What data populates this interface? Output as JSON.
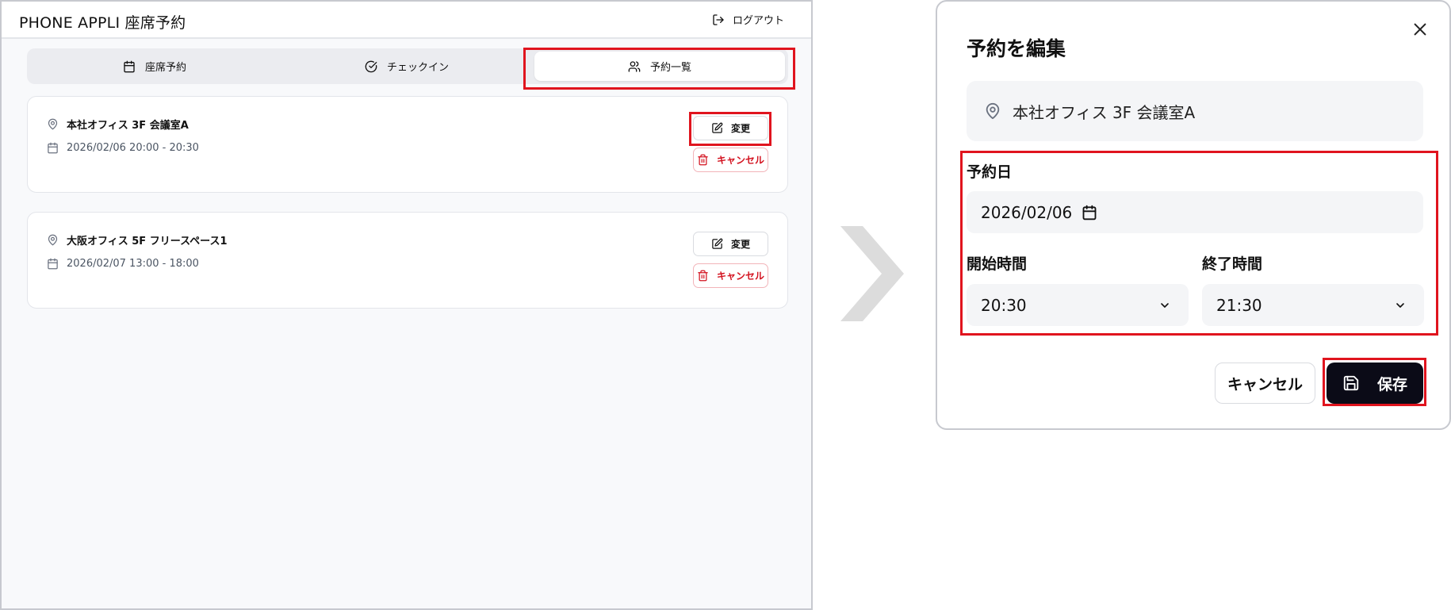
{
  "app": {
    "brand": "PHONE APPLI 座席予約",
    "logout_label": "ログアウト",
    "tabs": [
      {
        "label": "座席予約",
        "icon": "calendar-icon",
        "active": false
      },
      {
        "label": "チェックイン",
        "icon": "check-circle-icon",
        "active": false
      },
      {
        "label": "予約一覧",
        "icon": "users-icon",
        "active": true
      }
    ],
    "reservations": [
      {
        "location": "本社オフィス 3F 会議室A",
        "datetime": "2026/02/06 20:00 - 20:30",
        "edit_label": "変更",
        "cancel_label": "キャンセル"
      },
      {
        "location": "大阪オフィス 5F フリースペース1",
        "datetime": "2026/02/07 13:00 - 18:00",
        "edit_label": "変更",
        "cancel_label": "キャンセル"
      }
    ]
  },
  "modal": {
    "title": "予約を編集",
    "location": "本社オフィス 3F 会議室A",
    "date_label": "予約日",
    "date_value": "2026/02/06",
    "start_label": "開始時間",
    "start_value": "20:30",
    "end_label": "終了時間",
    "end_value": "21:30",
    "cancel_label": "キャンセル",
    "save_label": "保存"
  },
  "colors": {
    "highlight": "#e0141e",
    "danger": "#d3121f",
    "primary_dark": "#0b0b17",
    "surface_gray": "#f4f5f7"
  }
}
